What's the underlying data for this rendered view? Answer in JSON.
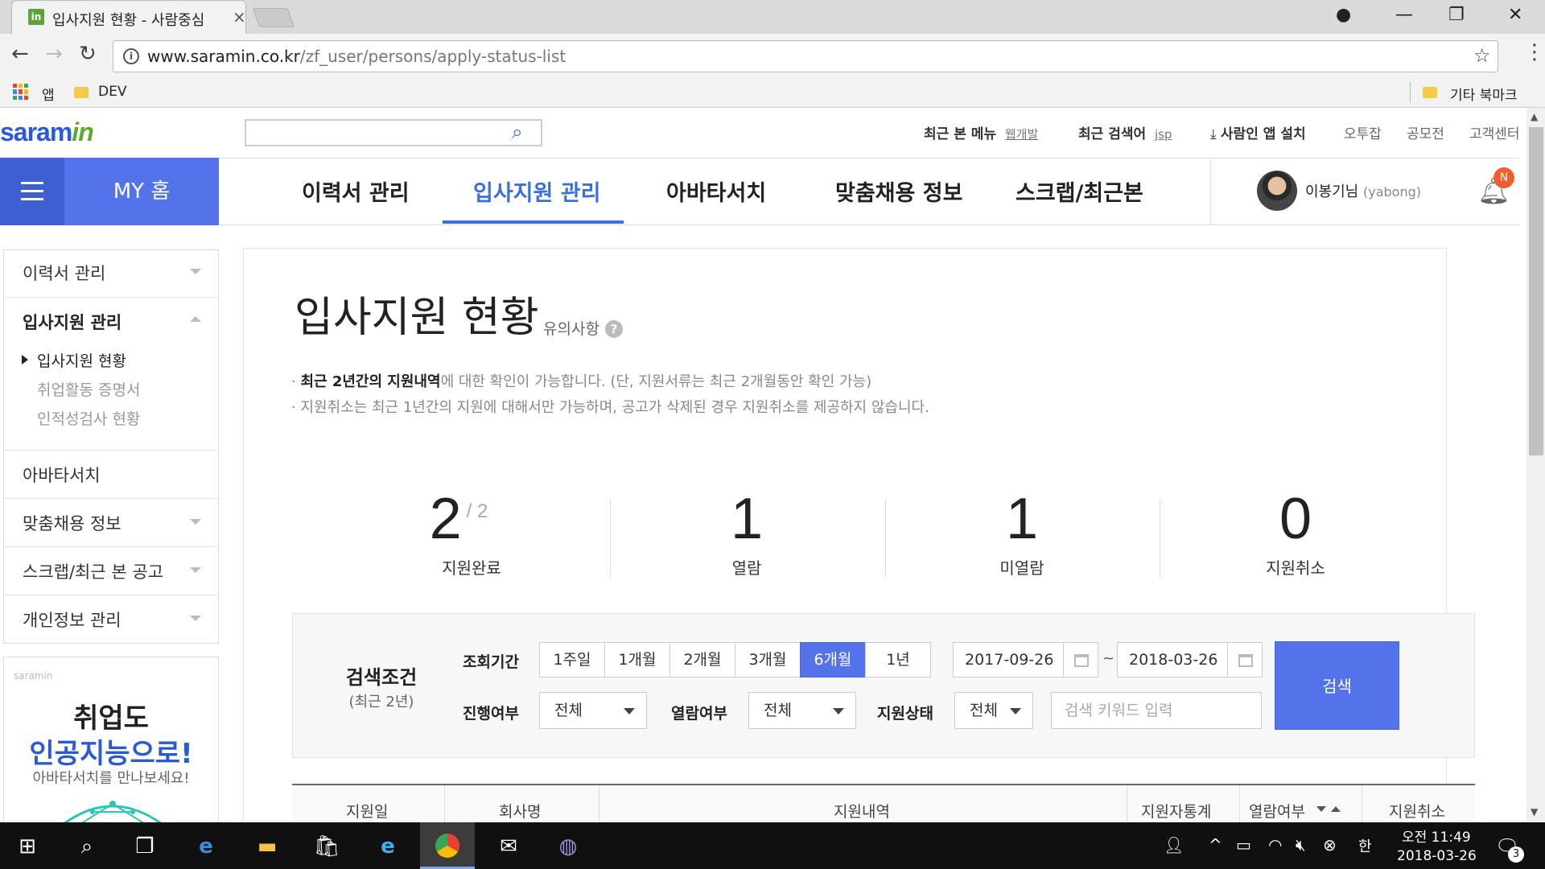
{
  "browser": {
    "tab_title": "입사지원 현황 - 사람중심",
    "tab_favicon": "in",
    "url_domain": "www.saramin.co.kr",
    "url_path": "/zf_user/persons/apply-status-list",
    "bookmarks": {
      "apps": "앱",
      "dev": "DEV",
      "other": "기타 북마크"
    }
  },
  "header": {
    "logo_main": "saram",
    "logo_in": "in",
    "search_placeholder": "",
    "recent_menu_label": "최근 본 메뉴",
    "recent_menu_value": "웹개발",
    "recent_search_label": "최근 검색어",
    "recent_search_value": "jsp",
    "app_install": "사람인 앱 설치",
    "links": [
      "오투잡",
      "공모전",
      "고객센터"
    ]
  },
  "gnb": {
    "my_home": "MY 홈",
    "items": [
      "이력서 관리",
      "입사지원 관리",
      "아바타서치",
      "맞춤채용 정보",
      "스크랩/최근본"
    ],
    "active_index": 1,
    "user_name": "이봉기님",
    "user_id": "(yabong)",
    "notification_badge": "N"
  },
  "sidebar": {
    "items": [
      "이력서 관리",
      "입사지원 관리",
      "아바타서치",
      "맞춤채용 정보",
      "스크랩/최근 본 공고",
      "개인정보 관리"
    ],
    "sub_items": [
      "입사지원 현황",
      "취업활동 증명서",
      "인적성검사 현황"
    ],
    "banner": {
      "brand": "saramin",
      "line1": "취업도",
      "line2": "인공지능으로!",
      "line3": "아바타서치를 만나보세요!"
    }
  },
  "main": {
    "title": "입사지원 현황",
    "notice_link": "유의사항",
    "note1_bold": "최근 2년간의 지원내역",
    "note1_rest": "에 대한 확인이 가능합니다. (단, 지원서류는 최근 2개월동안 확인 가능)",
    "note2": "지원취소는 최근 1년간의 지원에 대해서만 가능하며, 공고가 삭제된 경우 지원취소를 제공하지 않습니다.",
    "stats": [
      {
        "value": "2",
        "total": "/ 2",
        "label": "지원완료"
      },
      {
        "value": "1",
        "label": "열람"
      },
      {
        "value": "1",
        "label": "미열람"
      },
      {
        "value": "0",
        "label": "지원취소"
      }
    ]
  },
  "filter": {
    "title": "검색조건",
    "subtitle": "(최근 2년)",
    "period_label": "조회기간",
    "periods": [
      "1주일",
      "1개월",
      "2개월",
      "3개월",
      "6개월",
      "1년"
    ],
    "selected_period": "6개월",
    "date_from": "2017-09-26",
    "date_sep": "~",
    "date_to": "2018-03-26",
    "progress_label": "진행여부",
    "progress_value": "전체",
    "read_label": "열람여부",
    "read_value": "전체",
    "status_label": "지원상태",
    "status_value": "전체",
    "keyword_placeholder": "검색 키워드 입력",
    "search_button": "검색"
  },
  "table": {
    "headers": [
      "지원일",
      "회사명",
      "지원내역",
      "지원자통계",
      "열람여부",
      "지원취소"
    ]
  },
  "taskbar": {
    "time": "오전 11:49",
    "date": "2018-03-26",
    "ime": "한",
    "notification_count": "3"
  }
}
